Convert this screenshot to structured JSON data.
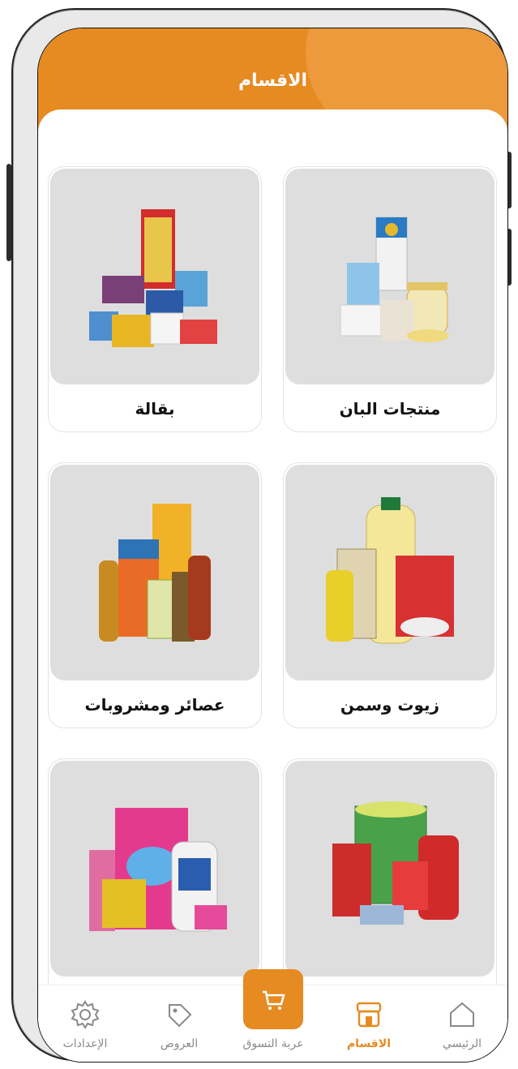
{
  "header": {
    "title": "الاقسام"
  },
  "categories": [
    {
      "label": "منتجات البان",
      "image_icon": "dairy-products-image"
    },
    {
      "label": "بقالة",
      "image_icon": "grocery-image"
    },
    {
      "label": "زيوت وسمن",
      "image_icon": "oils-image"
    },
    {
      "label": "عصائر ومشروبات",
      "image_icon": "juices-image"
    },
    {
      "label": "",
      "image_icon": "canned-goods-image"
    },
    {
      "label": "",
      "image_icon": "detergents-image"
    }
  ],
  "bottom_nav": {
    "home": "الرئيسي",
    "categories": "الاقسام",
    "cart": "عربة التسوق",
    "offers": "العروض",
    "settings": "الإعدادات"
  },
  "colors": {
    "accent": "#e68a22",
    "card_bg": "#dedede"
  }
}
